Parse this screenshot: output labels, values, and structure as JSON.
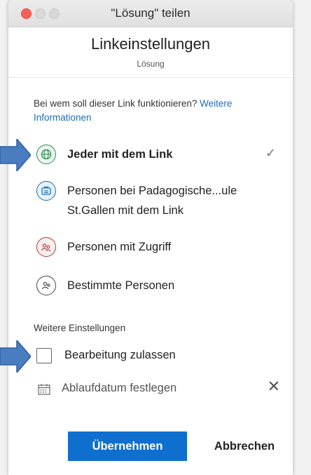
{
  "window": {
    "title": "\"Lösung\" teilen"
  },
  "header": {
    "title": "Linkeinstellungen",
    "subtitle": "Lösung"
  },
  "intro": {
    "text": "Bei wem soll dieser Link funktionieren?",
    "link": "Weitere Informationen"
  },
  "options": [
    {
      "label": "Jeder mit dem Link",
      "icon": "globe-icon",
      "selected": true
    },
    {
      "label_line1": "Personen bei Padagogische...ule",
      "label_line2": "St.Gallen mit dem Link",
      "icon": "organization-icon"
    },
    {
      "label": "Personen mit Zugriff",
      "icon": "people-access-icon"
    },
    {
      "label": "Bestimmte Personen",
      "icon": "specific-people-icon"
    }
  ],
  "settings": {
    "section_label": "Weitere Einstellungen",
    "allow_edit_label": "Bearbeitung zulassen",
    "allow_edit_checked": false,
    "expiry_label": "Ablaufdatum festlegen"
  },
  "buttons": {
    "apply": "Übernehmen",
    "cancel": "Abbrechen"
  },
  "colors": {
    "accent": "#0e6fcf",
    "link": "#1a6fb8",
    "pointer": "#4a7cc0",
    "close_button": "#fc5f57"
  }
}
